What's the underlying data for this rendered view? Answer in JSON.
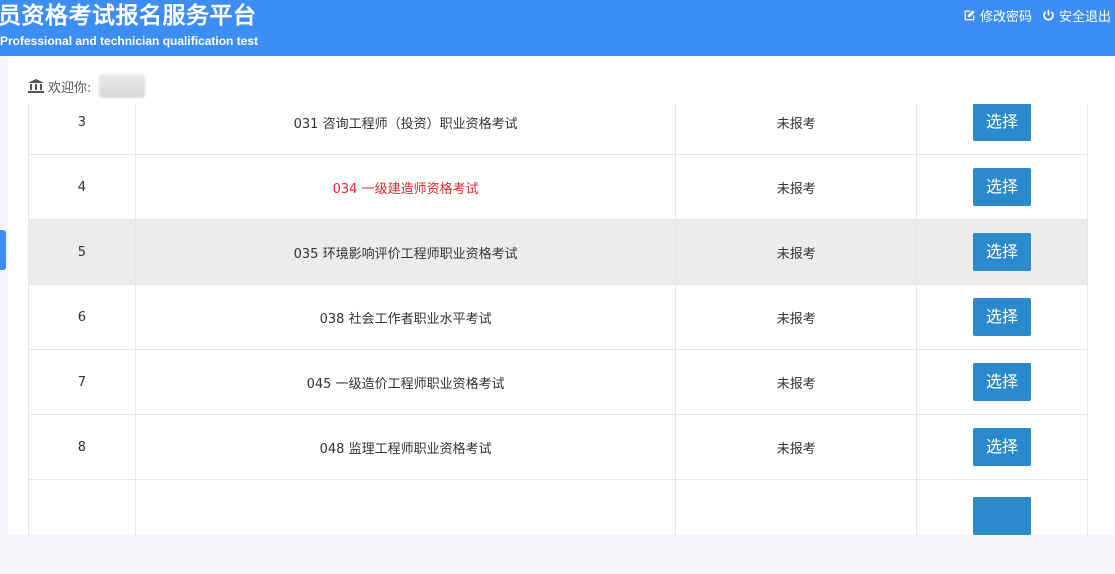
{
  "header": {
    "title": "员资格考试报名服务平台",
    "subtitle": "Professional and technician qualification test",
    "change_password": "修改密码",
    "logout": "安全退出"
  },
  "welcome": {
    "label": "欢迎你:"
  },
  "rows": [
    {
      "index": "",
      "name": "",
      "status": "",
      "button": ""
    },
    {
      "index": "3",
      "name": "031 咨询工程师（投资）职业资格考试",
      "status": "未报考",
      "button": "选择"
    },
    {
      "index": "4",
      "name": "034 一级建造师资格考试",
      "status": "未报考",
      "button": "选择",
      "highlight_text_color": "#e02a2a"
    },
    {
      "index": "5",
      "name": "035 环境影响评价工程师职业资格考试",
      "status": "未报考",
      "button": "选择",
      "row_highlight": true
    },
    {
      "index": "6",
      "name": "038 社会工作者职业水平考试",
      "status": "未报考",
      "button": "选择"
    },
    {
      "index": "7",
      "name": "045 一级造价工程师职业资格考试",
      "status": "未报考",
      "button": "选择"
    },
    {
      "index": "8",
      "name": "048 监理工程师职业资格考试",
      "status": "未报考",
      "button": "选择"
    },
    {
      "index": "",
      "name": "",
      "status": "",
      "button": ""
    }
  ],
  "colors": {
    "header_bg": "#3d8ef4",
    "button_bg": "#2a8acc",
    "highlight_text": "#e02a2a"
  }
}
